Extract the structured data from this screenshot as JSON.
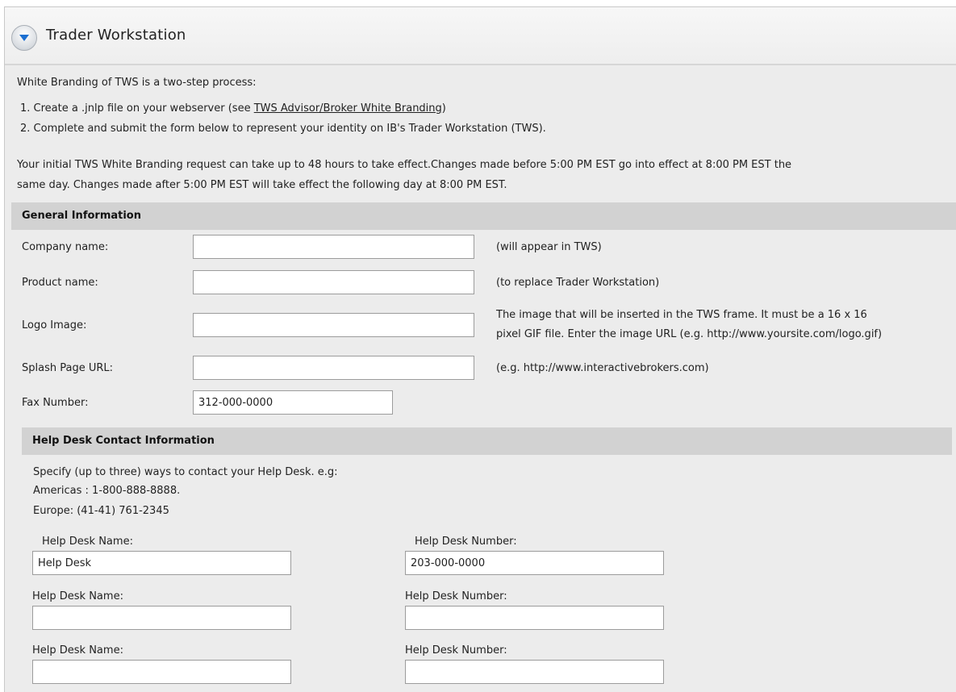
{
  "header": {
    "title": "Trader Workstation",
    "toggle_icon": "chevron-down-icon"
  },
  "intro": {
    "lead": "White Branding of TWS is a two-step process:",
    "step1_prefix": "1.  Create a .jnlp file on your webserver (see ",
    "step1_link": "TWS Advisor/Broker White Branding",
    "step1_suffix": ")",
    "step2": "2.  Complete and submit the form below to represent your identity on IB's Trader Workstation (TWS).",
    "notice_line1": "Your initial TWS White Branding request can take up to 48 hours to take effect.Changes made before 5:00 PM EST go into effect at 8:00 PM EST the",
    "notice_line2": "same day. Changes made after 5:00 PM EST will take effect the following day at 8:00 PM EST."
  },
  "general": {
    "heading": "General Information",
    "company_label": "Company name:",
    "company_value": "",
    "company_hint": "(will appear in TWS)",
    "product_label": "Product name:",
    "product_value": "",
    "product_hint": "(to replace Trader Workstation)",
    "logo_label": "Logo Image:",
    "logo_value": "",
    "logo_hint_line1": "The image that will be inserted in the TWS frame. It must be a 16 x 16",
    "logo_hint_line2": "pixel GIF file. Enter the image URL (e.g. http://www.yoursite.com/logo.gif)",
    "splash_label": "Splash Page URL:",
    "splash_value": "",
    "splash_hint": "(e.g. http://www.interactivebrokers.com)",
    "fax_label": "Fax Number:",
    "fax_value": "312-000-0000"
  },
  "helpdesk": {
    "heading": "Help Desk Contact Information",
    "desc_line1": "Specify (up to three) ways to contact your Help Desk. e.g:",
    "desc_line2": "Americas : 1-800-888-8888.",
    "desc_line3": "Europe: (41-41) 761-2345",
    "name_label": "Help Desk Name:",
    "number_label": "Help Desk Number:",
    "entries": [
      {
        "name": "Help Desk",
        "number": "203-000-0000"
      },
      {
        "name": "",
        "number": ""
      },
      {
        "name": "",
        "number": ""
      }
    ]
  }
}
